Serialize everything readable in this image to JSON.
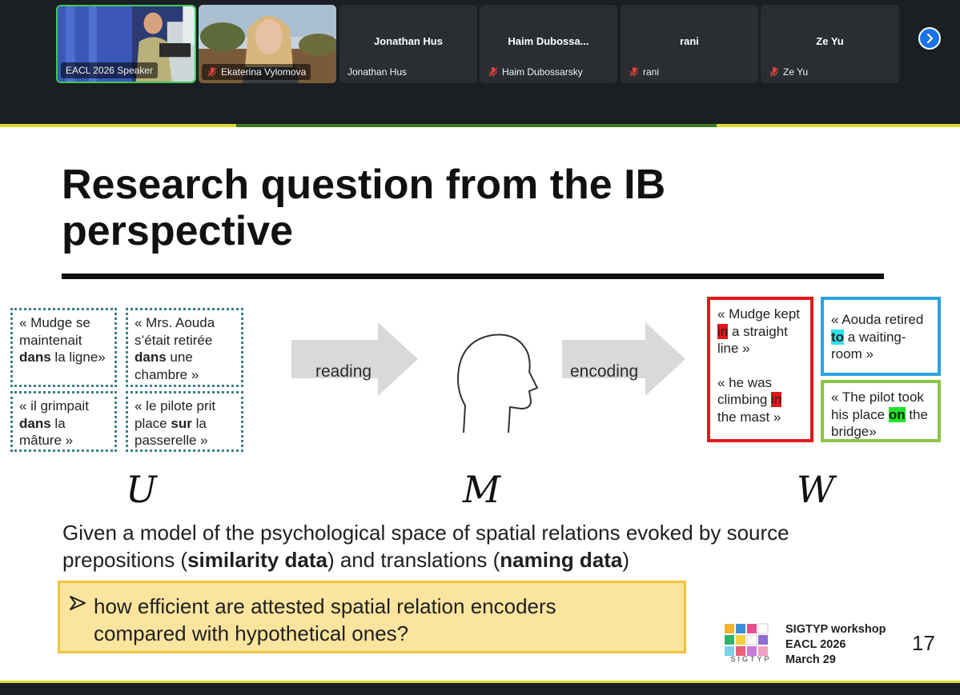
{
  "meeting": {
    "participants": [
      {
        "name": "EACL 2026 Speaker",
        "video": true,
        "muted": false,
        "active": true
      },
      {
        "name": "Ekaterina Vylomova",
        "video": true,
        "muted": true
      },
      {
        "name": "Jonathan Hus",
        "center_name": "Jonathan Hus",
        "video": false,
        "muted": false
      },
      {
        "name": "Haim Dubossarsky",
        "center_name": "Haim Dubossa...",
        "video": false,
        "muted": true
      },
      {
        "name": "rani",
        "center_name": "rani",
        "video": false,
        "muted": true
      },
      {
        "name": "Ze Yu",
        "center_name": "Ze Yu",
        "video": false,
        "muted": true
      }
    ],
    "next_icon": "chevron-right-icon"
  },
  "slide": {
    "title": "Research question from the IB perspective",
    "source_examples": [
      {
        "before": "« Mudge se maintenait ",
        "bold": "dans",
        "after": " la ligne»"
      },
      {
        "before": "« Mrs. Aouda s’était retirée ",
        "bold": "dans",
        "after": " une chambre »"
      },
      {
        "before": "« il grimpait ",
        "bold": "dans",
        "after": " la mâture »"
      },
      {
        "before": "« le pilote prit place ",
        "bold": "sur",
        "after": " la passerelle »"
      }
    ],
    "arrow_reading": "reading",
    "arrow_encoding": "encoding",
    "head_icon": "head-profile-icon",
    "target_red": [
      {
        "before": "« Mudge kept ",
        "hl": "in",
        "after": " a straight line »"
      },
      {
        "before": "« he was climbing ",
        "hl": "in",
        "after": " the mast »"
      }
    ],
    "target_blue": {
      "before": "« Aouda retired ",
      "hl": "to",
      "after": " a waiting-room »"
    },
    "target_green": {
      "before": "« The pilot took his place ",
      "hl": "on",
      "after": " the bridge»"
    },
    "var_u": "U",
    "var_m": "M",
    "var_w": "W",
    "given": {
      "part1": "Given a model of the psychological space of spatial relations evoked by source prepositions (",
      "bold1": "similarity data",
      "part2": ") and translations (",
      "bold2": "naming data",
      "part3": ")"
    },
    "question": "how efficient are attested spatial relation encoders compared with hypothetical ones?",
    "logo_caption": "SIGTYP",
    "workshop_line1": "SIGTYP workshop",
    "workshop_line2": "EACL 2026",
    "workshop_line3": "March 29",
    "page_number": "17"
  },
  "colors": {
    "accent_red": "#e4161b",
    "accent_blue": "#29a3e0",
    "accent_green": "#8cc443",
    "question_bg": "#fbe49e",
    "dotted_teal": "#3a7e8a"
  }
}
